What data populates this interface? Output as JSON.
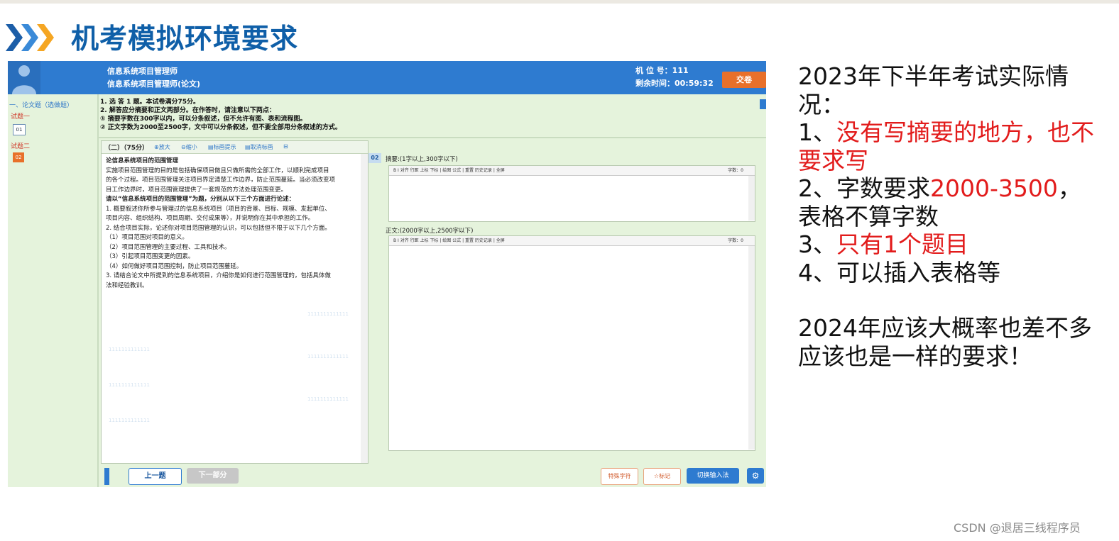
{
  "slide": {
    "title": "机考模拟环境要求"
  },
  "exam": {
    "header": {
      "subject": "信息系统项目管理师",
      "paper": "信息系统项目管理师(论文)",
      "seat": "机 位 号：111",
      "time_left": "剩余时间：00:59:32",
      "submit_label": "交卷"
    },
    "sidebar": {
      "section": "一、论文题（选做题）",
      "q1_label": "试题一",
      "q1_num": "01",
      "q2_label": "试题二",
      "q2_num": "02"
    },
    "instructions": [
      "1. 选    答    1    题。本试卷满分75分。",
      "2. 解答应分摘要和正文两部分。在作答时，请注意以下两点：",
      "    ① 摘要字数在300字以内，可以分条叙述，但不允许有图、表和流程图。",
      "    ② 正文字数为2000至2500字，文中可以分条叙述，但不要全部用分条叙述的方式。"
    ],
    "question_toolbar": {
      "label": "（二）（75分）",
      "zoom_in": "放大",
      "zoom_out": "缩小",
      "highlight": "标画提示",
      "unhighlight": "取消标画"
    },
    "question": {
      "title": "论信息系统项目的范围管理",
      "lines": [
        "    实施项目范围管理的目的是包括确保项目做且只做所需的全部工作，以顺利完成项目",
        "的各个过程。项目范围管理关注项目界定清楚工作边界，防止范围蔓延。当必须改变项",
        "目工作边界时，项目范围管理提供了一套规范的方法处理范围变更。",
        "    请以“信息系统项目的范围管理”为题，分别从以下三个方面进行论述：",
        "    1. 概要叙述你所参与管理过的信息系统项目（项目的背景、目标、规模、发起单位、",
        "项目内容、组织结构、项目周期、交付成果等），并说明你在其中承担的工作。",
        "    2. 结合项目实际，论述你对项目范围管理的认识，可以包括但不限于以下几个方面。",
        "    （1）项目范围对项目的意义。",
        "    （2）项目范围管理的主要过程、工具和技术。",
        "    （3）引起项目范围变更的因素。",
        "    （4）如何做好项目范围控制，防止项目范围蔓延。",
        "    3. 请结合论文中所提到的信息系统项目，介绍你是如何进行范围管理的，包括具体做",
        "法和经验教训。"
      ]
    },
    "answer": {
      "qnum": "02",
      "abstract_label": "摘要:(1字以上,300字以下)",
      "main_label": "正文:(2000字以上,2500字以下)",
      "editor_tools": "B    I    对齐  行距  上标  下标  |  绘图  公式  |  重置  历史记录  |  全屏",
      "word_count": "字数：0"
    },
    "footer": {
      "prev": "上一题",
      "next": "下一部分",
      "special": "特殊字符",
      "mark": "标记",
      "ime": "切换输入法"
    },
    "watermark": "1111111111111"
  },
  "notes": {
    "heading": "2023年下半年考试实际情况：",
    "i1_prefix": "1、",
    "i1_red": "没有写摘要的地方，也不要求写",
    "i2_prefix": "2、字数要求",
    "i2_red": "2000-3500",
    "i2_suffix": "，",
    "i2_line2": "表格不算字数",
    "i3_prefix": "3、",
    "i3_red": "只有1个题目",
    "i4": "4、可以插入表格等",
    "outlook1": "2024年应该大概率也差不多",
    "outlook2": "应该也是一样的要求！"
  },
  "credit": "CSDN @退居三线程序员",
  "colors": {
    "title_blue": "#0f5fa8",
    "header_blue": "#2e7bd0",
    "submit_orange": "#e8702a",
    "exam_bg": "#e5f3dc",
    "accent_red": "#e21b1b"
  }
}
